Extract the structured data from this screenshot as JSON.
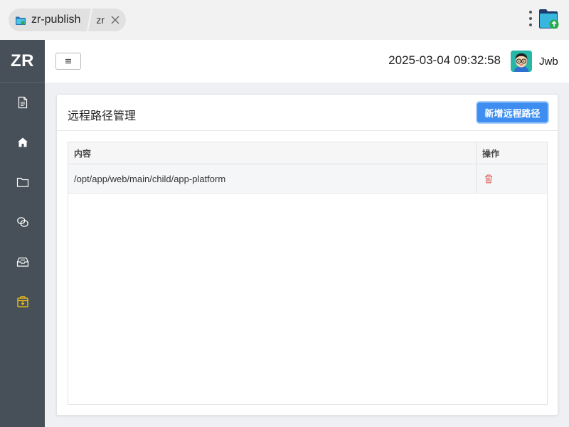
{
  "titlebar": {
    "tab_main_label": "zr-publish",
    "tab_sub_label": "zr",
    "app_icon": "folder-app-icon",
    "close_icon": "close-icon",
    "menu_icon": "kebab-icon",
    "upload_icon": "folder-upload-icon"
  },
  "sidebar": {
    "logo": "ZR",
    "items": [
      {
        "icon": "document-icon",
        "active": false
      },
      {
        "icon": "home-icon",
        "active": false
      },
      {
        "icon": "folder-icon",
        "active": false
      },
      {
        "icon": "link-icon",
        "active": false
      },
      {
        "icon": "inbox-icon",
        "active": false
      },
      {
        "icon": "package-icon",
        "active": true
      }
    ],
    "colors": {
      "bg": "#475058",
      "icon": "#ffffff",
      "active": "#f5c518"
    }
  },
  "header": {
    "datetime": "2025-03-04 09:32:58",
    "username": "Jwb",
    "menu_icon": "hamburger-icon",
    "avatar_icon": "avatar"
  },
  "main": {
    "title": "远程路径管理",
    "add_button_label": "新增远程路径",
    "accent": "#3d8ef0",
    "table": {
      "columns": [
        "内容",
        "操作"
      ],
      "rows": [
        {
          "content": "/opt/app/web/main/child/app-platform",
          "action_icon": "trash-icon"
        }
      ]
    }
  }
}
